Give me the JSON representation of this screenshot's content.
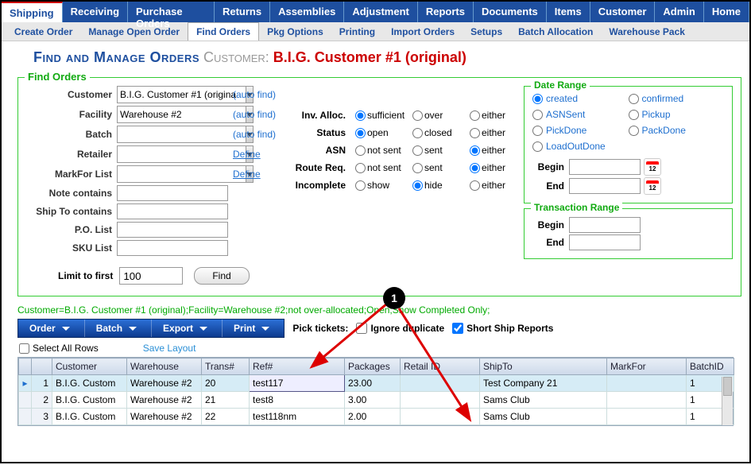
{
  "topnav": {
    "items": [
      "Shipping",
      "Receiving",
      "Purchase Orders",
      "Returns",
      "Assemblies",
      "Adjustment",
      "Reports",
      "Documents",
      "Items",
      "Customer",
      "Admin",
      "Home"
    ],
    "active": 0
  },
  "subnav": {
    "items": [
      "Create Order",
      "Manage Open Order",
      "Find Orders",
      "Pkg Options",
      "Printing",
      "Import Orders",
      "Setups",
      "Batch Allocation",
      "Warehouse Pack"
    ],
    "active": 2
  },
  "page_title": {
    "prefix": "Find and Manage Orders",
    "mid": "Customer:",
    "customer": "B.I.G. Customer #1 (original)"
  },
  "find_orders": {
    "legend": "Find Orders",
    "labels": {
      "customer": "Customer",
      "facility": "Facility",
      "batch": "Batch",
      "retailer": "Retailer",
      "markfor": "MarkFor List",
      "note": "Note contains",
      "shipto": "Ship To contains",
      "polist": "P.O. List",
      "skulist": "SKU List",
      "autofind": "(auto find)",
      "define": "Define",
      "limit": "Limit to first",
      "find_btn": "Find"
    },
    "values": {
      "customer": "B.I.G. Customer #1 (origina",
      "facility": "Warehouse #2",
      "batch": "",
      "retailer": "",
      "markfor": "",
      "note": "",
      "shipto": "",
      "polist": "",
      "skulist": "",
      "limit": "100"
    },
    "mid": {
      "rows": [
        {
          "label": "Inv. Alloc.",
          "opts": [
            "sufficient",
            "over",
            "either"
          ],
          "sel": 0
        },
        {
          "label": "Status",
          "opts": [
            "open",
            "closed",
            "either"
          ],
          "sel": 0
        },
        {
          "label": "ASN",
          "opts": [
            "not sent",
            "sent",
            "either"
          ],
          "sel": 2
        },
        {
          "label": "Route Req.",
          "opts": [
            "not sent",
            "sent",
            "either"
          ],
          "sel": 2
        },
        {
          "label": "Incomplete",
          "opts": [
            "show",
            "hide",
            "either"
          ],
          "sel": 1
        }
      ]
    },
    "date_range": {
      "legend": "Date Range",
      "opts": [
        "created",
        "confirmed",
        "ASNSent",
        "Pickup",
        "PickDone",
        "PackDone",
        "LoadOutDone"
      ],
      "sel": 0,
      "begin_label": "Begin",
      "end_label": "End",
      "begin": "",
      "end": ""
    },
    "trans_range": {
      "legend": "Transaction Range",
      "begin_label": "Begin",
      "end_label": "End",
      "begin": "",
      "end": ""
    }
  },
  "filter_summary": "Customer=B.I.G. Customer #1 (original);Facility=Warehouse #2;not over-allocated;Open;Show Completed Only;",
  "actionbar": {
    "items": [
      "Order",
      "Batch",
      "Export",
      "Print"
    ],
    "pick_label": "Pick tickets:",
    "ignore_dup": "Ignore duplicate",
    "short_ship": "Short Ship Reports",
    "ignore_checked": false,
    "short_checked": true
  },
  "select_row": {
    "select_all": "Select All Rows",
    "save_layout": "Save Layout"
  },
  "grid": {
    "cols": [
      "",
      "",
      "Customer",
      "Warehouse",
      "Trans#",
      "Ref#",
      "Packages",
      "Retail ID",
      "ShipTo",
      "MarkFor",
      "BatchID"
    ],
    "rows": [
      {
        "n": "1",
        "customer": "B.I.G. Custom",
        "warehouse": "Warehouse #2",
        "trans": "20",
        "ref": "test117",
        "packages": "23.00",
        "retail": "",
        "shipto": "Test Company 21",
        "markfor": "",
        "batchid": "1",
        "selected": true,
        "caret": true
      },
      {
        "n": "2",
        "customer": "B.I.G. Custom",
        "warehouse": "Warehouse #2",
        "trans": "21",
        "ref": "test8",
        "packages": "3.00",
        "retail": "",
        "shipto": "Sams Club",
        "markfor": "",
        "batchid": "1",
        "selected": false,
        "caret": false
      },
      {
        "n": "3",
        "customer": "B.I.G. Custom",
        "warehouse": "Warehouse #2",
        "trans": "22",
        "ref": "test118nm",
        "packages": "2.00",
        "retail": "",
        "shipto": "Sams Club",
        "markfor": "",
        "batchid": "1",
        "selected": false,
        "caret": false
      }
    ]
  },
  "annotation": {
    "num": "1"
  }
}
